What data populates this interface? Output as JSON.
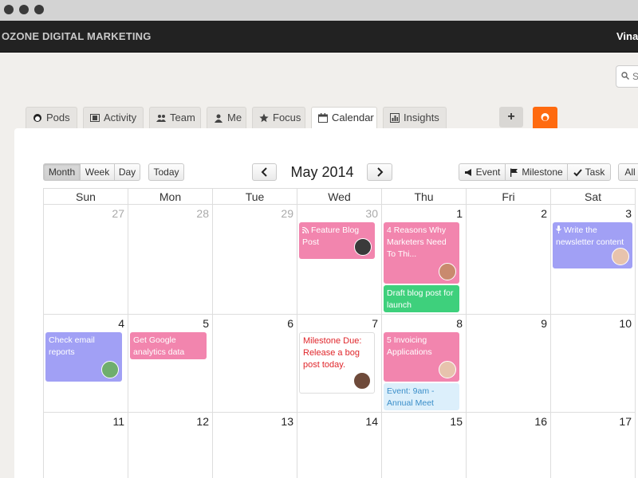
{
  "app": {
    "brand": "OZONE DIGITAL MARKETING",
    "user": "Vinay"
  },
  "search": {
    "placeholder": "S"
  },
  "tabs": [
    {
      "label": "Pods",
      "icon": "pods-icon"
    },
    {
      "label": "Activity",
      "icon": "film-icon"
    },
    {
      "label": "Team",
      "icon": "team-icon"
    },
    {
      "label": "Me",
      "icon": "user-icon"
    },
    {
      "label": "Focus",
      "icon": "star-icon"
    },
    {
      "label": "Calendar",
      "icon": "calendar-icon",
      "active": true
    },
    {
      "label": "Insights",
      "icon": "chart-icon"
    }
  ],
  "add_tab": "+",
  "toolbar": {
    "views": [
      "Month",
      "Week",
      "Day"
    ],
    "active_view": "Month",
    "today": "Today",
    "prev": "‹",
    "next": "›",
    "month_title": "May 2014",
    "actions": [
      "Event",
      "Milestone",
      "Task",
      "All"
    ]
  },
  "weekdays": [
    "Sun",
    "Mon",
    "Tue",
    "Wed",
    "Thu",
    "Fri",
    "Sat"
  ],
  "weeks": [
    [
      "27",
      "28",
      "29",
      "30",
      "1",
      "2",
      "3"
    ],
    [
      "4",
      "5",
      "6",
      "7",
      "8",
      "9",
      "10"
    ],
    [
      "11",
      "12",
      "13",
      "14",
      "15",
      "16",
      "17"
    ]
  ],
  "events": {
    "feature_blog": "Feature Blog Post",
    "reasons": "4 Reasons Why Marketers Need To Thi...",
    "draft": "Draft blog post for launch",
    "newsletter": "Write the newsletter content",
    "check_email": "Check email reports",
    "analytics": "Get Google analytics data",
    "milestone": "Milestone Due: Release a bog post today.",
    "invoicing": "5 Invoicing Applications",
    "annual": "Event: 9am - Annual Meet"
  },
  "colors": {
    "pink": "#f285ae",
    "green": "#3ed07c",
    "purple": "#a1a0f5",
    "orange": "#ff6a0f",
    "red": "#e0262b"
  }
}
